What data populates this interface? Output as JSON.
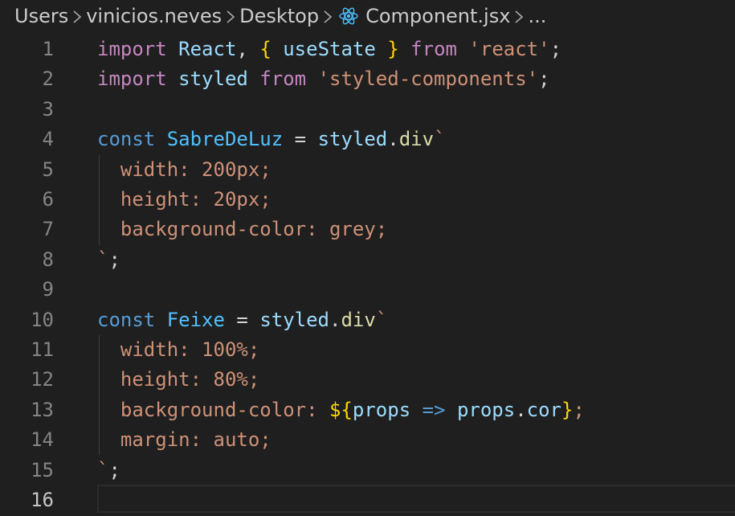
{
  "breadcrumb": {
    "items": [
      "Users",
      "vinicios.neves",
      "Desktop",
      "Component.jsx",
      "..."
    ],
    "file_icon": "react-icon"
  },
  "editor": {
    "active_line": 16,
    "lines": [
      {
        "n": "1",
        "tokens": [
          {
            "t": "import",
            "c": "kw-import"
          },
          {
            "t": " ",
            "c": "punc"
          },
          {
            "t": "React",
            "c": "id-var"
          },
          {
            "t": ", ",
            "c": "punc"
          },
          {
            "t": "{",
            "c": "brace"
          },
          {
            "t": " ",
            "c": "punc"
          },
          {
            "t": "useState",
            "c": "id-var"
          },
          {
            "t": " ",
            "c": "punc"
          },
          {
            "t": "}",
            "c": "brace"
          },
          {
            "t": " ",
            "c": "punc"
          },
          {
            "t": "from",
            "c": "kw-import"
          },
          {
            "t": " ",
            "c": "punc"
          },
          {
            "t": "'react'",
            "c": "str"
          },
          {
            "t": ";",
            "c": "punc"
          }
        ]
      },
      {
        "n": "2",
        "tokens": [
          {
            "t": "import",
            "c": "kw-import"
          },
          {
            "t": " ",
            "c": "punc"
          },
          {
            "t": "styled",
            "c": "id-var"
          },
          {
            "t": " ",
            "c": "punc"
          },
          {
            "t": "from",
            "c": "kw-import"
          },
          {
            "t": " ",
            "c": "punc"
          },
          {
            "t": "'styled-components'",
            "c": "str"
          },
          {
            "t": ";",
            "c": "punc"
          }
        ]
      },
      {
        "n": "3",
        "tokens": []
      },
      {
        "n": "4",
        "tokens": [
          {
            "t": "const",
            "c": "kw-const"
          },
          {
            "t": " ",
            "c": "punc"
          },
          {
            "t": "SabreDeLuz",
            "c": "id-const"
          },
          {
            "t": " = ",
            "c": "punc"
          },
          {
            "t": "styled",
            "c": "id-var"
          },
          {
            "t": ".",
            "c": "punc"
          },
          {
            "t": "div",
            "c": "fn"
          },
          {
            "t": "`",
            "c": "str"
          }
        ]
      },
      {
        "n": "5",
        "tokens": [
          {
            "t": "  width: 200px;",
            "c": "css"
          }
        ]
      },
      {
        "n": "6",
        "tokens": [
          {
            "t": "  height: 20px;",
            "c": "css"
          }
        ]
      },
      {
        "n": "7",
        "tokens": [
          {
            "t": "  background-color: grey;",
            "c": "css"
          }
        ]
      },
      {
        "n": "8",
        "tokens": [
          {
            "t": "`",
            "c": "str"
          },
          {
            "t": ";",
            "c": "punc"
          }
        ]
      },
      {
        "n": "9",
        "tokens": []
      },
      {
        "n": "10",
        "tokens": [
          {
            "t": "const",
            "c": "kw-const"
          },
          {
            "t": " ",
            "c": "punc"
          },
          {
            "t": "Feixe",
            "c": "id-const"
          },
          {
            "t": " = ",
            "c": "punc"
          },
          {
            "t": "styled",
            "c": "id-var"
          },
          {
            "t": ".",
            "c": "punc"
          },
          {
            "t": "div",
            "c": "fn"
          },
          {
            "t": "`",
            "c": "str"
          }
        ]
      },
      {
        "n": "11",
        "tokens": [
          {
            "t": "  width: 100%;",
            "c": "css"
          }
        ]
      },
      {
        "n": "12",
        "tokens": [
          {
            "t": "  height: 80%;",
            "c": "css"
          }
        ]
      },
      {
        "n": "13",
        "tokens": [
          {
            "t": "  background-color: ",
            "c": "css"
          },
          {
            "t": "${",
            "c": "brace"
          },
          {
            "t": "props",
            "c": "id-var"
          },
          {
            "t": " ",
            "c": "punc"
          },
          {
            "t": "=>",
            "c": "arrow"
          },
          {
            "t": " ",
            "c": "punc"
          },
          {
            "t": "props",
            "c": "id-var"
          },
          {
            "t": ".",
            "c": "punc"
          },
          {
            "t": "cor",
            "c": "id-var"
          },
          {
            "t": "}",
            "c": "brace"
          },
          {
            "t": ";",
            "c": "css"
          }
        ]
      },
      {
        "n": "14",
        "tokens": [
          {
            "t": "  margin: auto;",
            "c": "css"
          }
        ]
      },
      {
        "n": "15",
        "tokens": [
          {
            "t": "`",
            "c": "str"
          },
          {
            "t": ";",
            "c": "punc"
          }
        ]
      },
      {
        "n": "16",
        "tokens": []
      }
    ]
  },
  "colors": {
    "background": "#1f1f1f",
    "keyword_import": "#c586c0",
    "keyword_const": "#569cd6",
    "identifier": "#9cdcfe",
    "constant": "#4fc1ff",
    "function": "#dcdcaa",
    "string": "#ce9178",
    "bracket": "#ffd700",
    "line_number": "#858585",
    "react_icon": "#4fc1ff"
  }
}
